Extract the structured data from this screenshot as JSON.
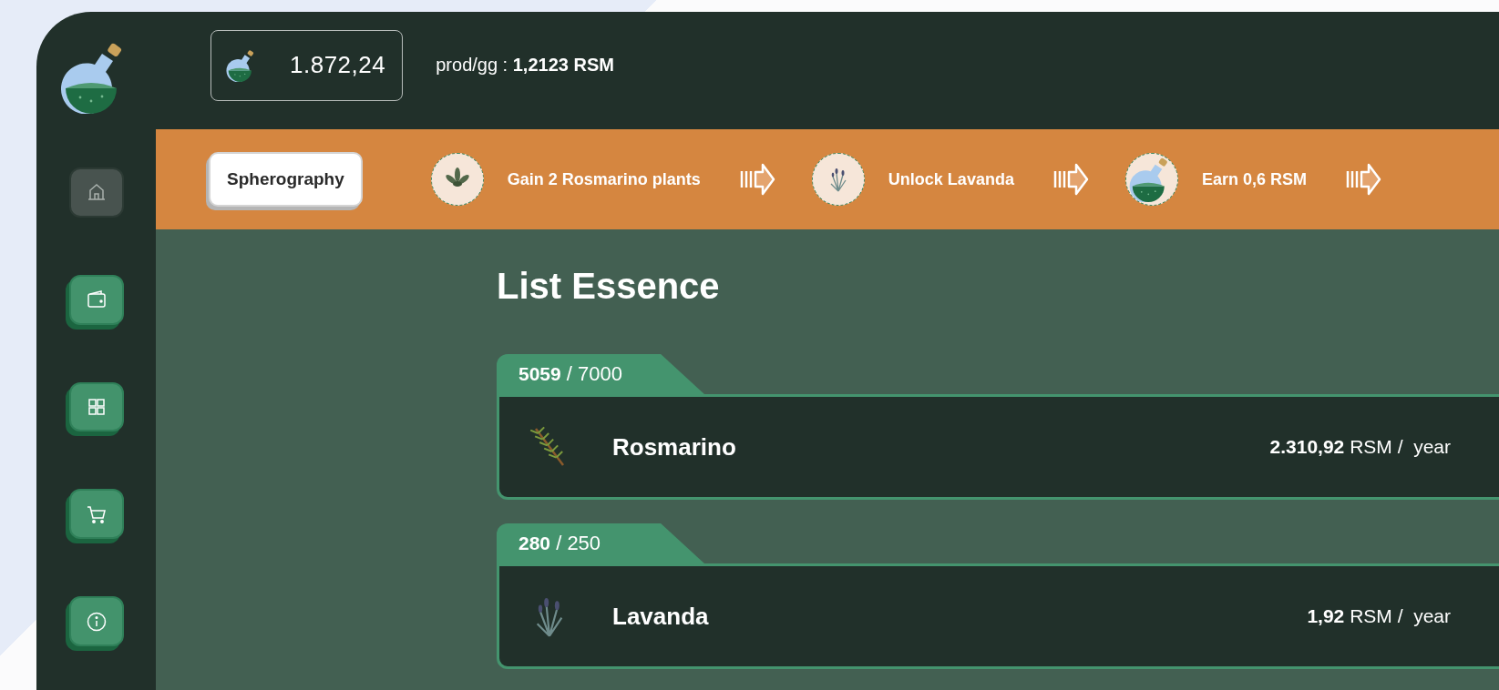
{
  "balance": {
    "amount": "1.872,24"
  },
  "production": "prod/gg : **1,2123 RSM**",
  "nav": [
    {
      "kind": "home",
      "selected": true
    },
    {
      "kind": "wallet",
      "selected": false
    },
    {
      "kind": "grid",
      "selected": false
    },
    {
      "kind": "cart",
      "selected": false
    },
    {
      "kind": "info",
      "selected": false
    }
  ],
  "quest_bar": {
    "button": "Spherography",
    "steps": [
      {
        "kind": "herb",
        "label": "Gain 2 Rosmarino plants"
      },
      {
        "kind": "lavender",
        "label": "Unlock Lavanda"
      },
      {
        "kind": "flask",
        "label": "Earn 0,6 RSM"
      }
    ]
  },
  "title": "List Essence",
  "essences": [
    {
      "kind": "rosemary",
      "stock": "**5059** / 7000",
      "name": "Rosmarino",
      "rate": "**2.310,92** RSM /  year"
    },
    {
      "kind": "lavender",
      "stock": "**280** / 250",
      "name": "Lavanda",
      "rate": "**1,92** RSM /  year"
    }
  ]
}
